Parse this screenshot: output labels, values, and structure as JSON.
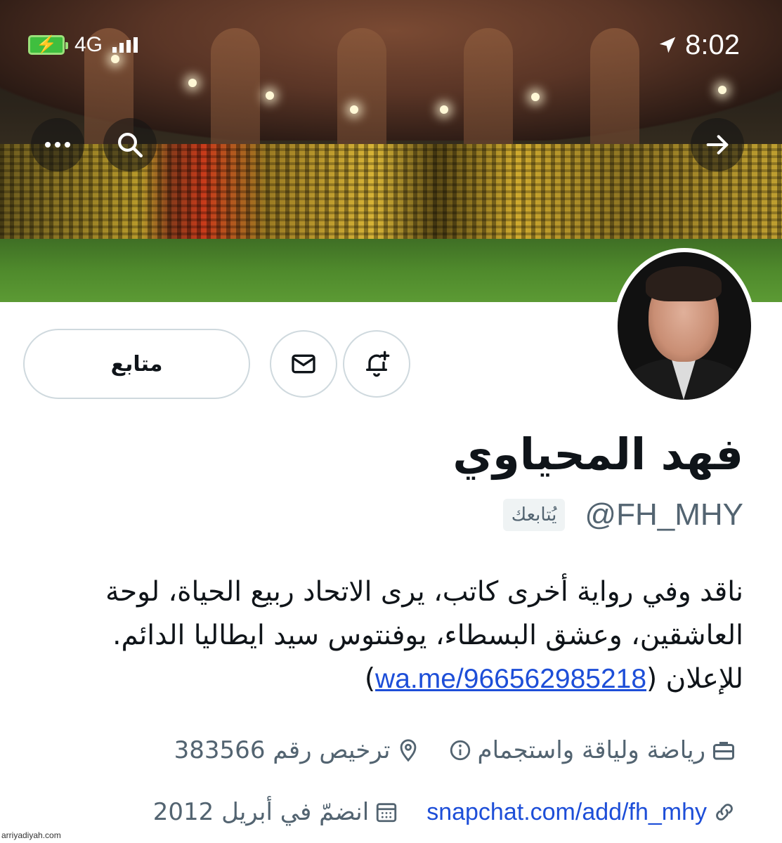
{
  "status_bar": {
    "network": "4G",
    "time": "8:02",
    "icons": [
      "battery-charging-icon",
      "signal-icon",
      "location-arrow-icon"
    ]
  },
  "header": {
    "icons": [
      "more-icon",
      "search-icon",
      "back-arrow-icon"
    ]
  },
  "actions": {
    "follow_label": "متابع",
    "icons": [
      "mail-icon",
      "notification-bell-icon"
    ]
  },
  "profile": {
    "name": "فهد المحياوي",
    "handle": "@FH_MHY",
    "follows_you": "يُتابعك",
    "bio_lines": [
      "ناقد وفي رواية أخرى كاتب، يرى الاتحاد ربيع الحياة، لوحة",
      "العاشقين، وعشق البسطاء، يوفنتوس سيد ايطاليا الدائم."
    ],
    "bio_ad_label": "للإعلان",
    "bio_link": "wa.me/966562985218",
    "category": "رياضة ولياقة واستجمام",
    "location": "ترخيص رقم 383566",
    "website": "snapchat.com/add/fh_mhy",
    "joined": "انضمّ في أبريل 2012"
  },
  "watermark": "arriyadiyah.com",
  "colors": {
    "link": "#1d4ed8",
    "secondary_text": "#536471",
    "border": "#cfd9de"
  }
}
